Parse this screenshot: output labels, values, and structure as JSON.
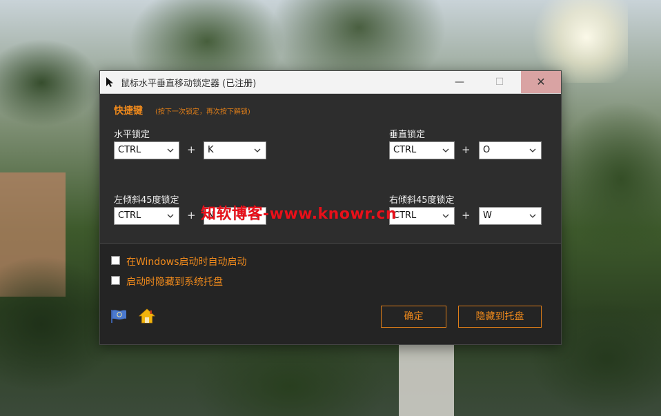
{
  "window": {
    "title": "鼠标水平垂直移动锁定器 (已注册)",
    "controls": {
      "minimize": "—",
      "maximize": "☐",
      "close": "✕"
    }
  },
  "hotkeys": {
    "section_title": "快捷键",
    "hint": "(按下一次锁定，再次按下解锁)",
    "plus": "+",
    "horizontal": {
      "label": "水平锁定",
      "modifier": "CTRL",
      "key": "K"
    },
    "vertical": {
      "label": "垂直锁定",
      "modifier": "CTRL",
      "key": "O"
    },
    "left_tilt": {
      "label": "左倾斜45度锁定",
      "modifier": "CTRL",
      "key": "N"
    },
    "right_tilt": {
      "label": "右倾斜45度锁定",
      "modifier": "CTRL",
      "key": "W"
    }
  },
  "watermark": "知软博客-www.knowr.cn",
  "options": {
    "autostart": {
      "label": "在Windows启动时自动启动",
      "checked": false
    },
    "hide_to_tray": {
      "label": "启动时隐藏到系统托盘",
      "checked": false
    }
  },
  "icons": {
    "flag": "flag-icon",
    "home": "home-icon"
  },
  "buttons": {
    "ok": "确定",
    "hide_to_tray": "隐藏到托盘"
  },
  "colors": {
    "accent": "#f08a1c",
    "window_bg": "#2b2b2b",
    "close_hover": "#d9a3a3",
    "watermark": "#e8101a"
  }
}
